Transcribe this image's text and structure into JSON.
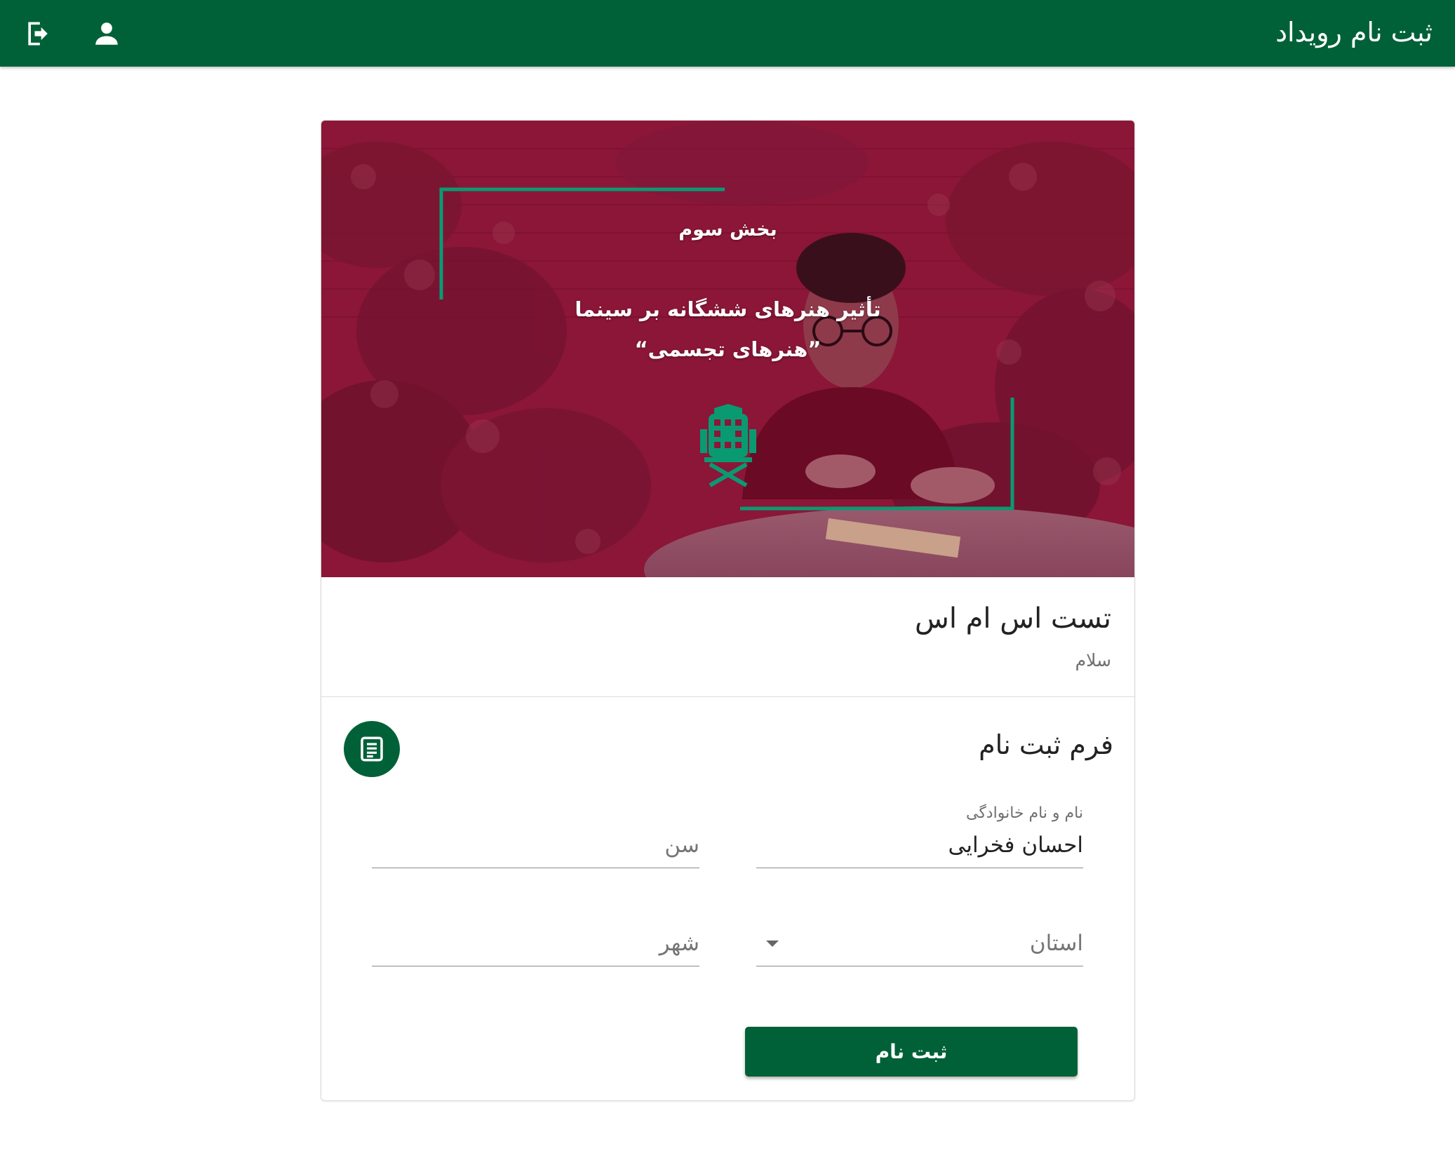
{
  "appbar": {
    "title": "ثبت نام رویداد",
    "logout_icon": "logout-icon",
    "user_icon": "account-icon",
    "color": "#006138"
  },
  "banner": {
    "line1": "بخش سوم",
    "line2": "تأثیر هنرهای ششگانه بر سینما",
    "line3": "”هنرهای تجسمی“",
    "overlay_color": "#8b1034",
    "accent_color": "#0a9a72",
    "logo_icon": "film-director-chair-icon"
  },
  "event": {
    "title": "تست اس ام اس",
    "subtitle": "سلام"
  },
  "form": {
    "title": "فرم ثبت نام",
    "icon": "form-document-icon",
    "fields": {
      "name": {
        "label": "نام و نام خانوادگی",
        "value": "احسان فخرایی"
      },
      "age": {
        "placeholder": "سن"
      },
      "province": {
        "placeholder": "استان"
      },
      "city": {
        "placeholder": "شهر"
      }
    },
    "submit_label": "ثبت نام"
  }
}
